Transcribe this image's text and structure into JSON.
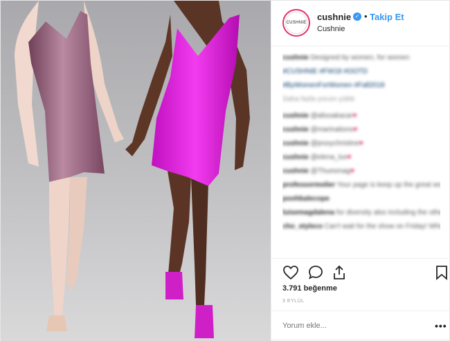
{
  "header": {
    "avatar_text": "CUSHNIE",
    "username": "cushnie",
    "verified": true,
    "separator": "•",
    "follow_label": "Takip Et",
    "location": "Cushnie"
  },
  "comments": [
    {
      "user": "cushnie",
      "text": "Designed by women, for women",
      "blur": true
    },
    {
      "user": "",
      "text": "#CUSHNIE #FW18 #OOTD",
      "blur": true,
      "blue": true
    },
    {
      "user": "",
      "text": "#ByWomenForWomen #Fall2018",
      "blur": true,
      "blue": true
    },
    {
      "user": "",
      "text": "Daha fazla yorum yükle",
      "blur": true,
      "more": true
    },
    {
      "user": "cushnie",
      "text": "@alisoakacar",
      "blur": true,
      "heart": true
    },
    {
      "user": "cushnie",
      "text": "@marinations",
      "blur": true,
      "heart": true
    },
    {
      "user": "cushnie",
      "text": "@jessychristine",
      "blur": true,
      "heart": true
    },
    {
      "user": "cushnie",
      "text": "@elena_lux",
      "blur": true,
      "heart": true
    },
    {
      "user": "cushnie",
      "text": "@Thuesmag",
      "blur": true,
      "heart": true
    },
    {
      "user": "professormolier",
      "text": "Your page is keep up the great work!",
      "blur": true
    },
    {
      "user": "poohbalecope",
      "text": "",
      "blur": true
    },
    {
      "user": "luisemagdalena",
      "text": "for diversity also including the other direction - pale",
      "blur": true
    },
    {
      "user": "cho_styleco",
      "text": "Can't wait for the show on Friday! Which is actually Saturday in Sydney",
      "blur": true
    }
  ],
  "actions": {
    "like_icon": "heart-outline-icon",
    "comment_icon": "comment-bubble-icon",
    "share_icon": "share-icon",
    "save_icon": "bookmark-icon"
  },
  "likes_text": "3.791 beğenme",
  "date_text": "3 EYLÜL",
  "add_comment": {
    "placeholder": "Yorum ekle...",
    "more_icon": "•••"
  },
  "colors": {
    "accent": "#3897f0",
    "dress_left": "#8a5470",
    "dress_right": "#e21ee0"
  }
}
